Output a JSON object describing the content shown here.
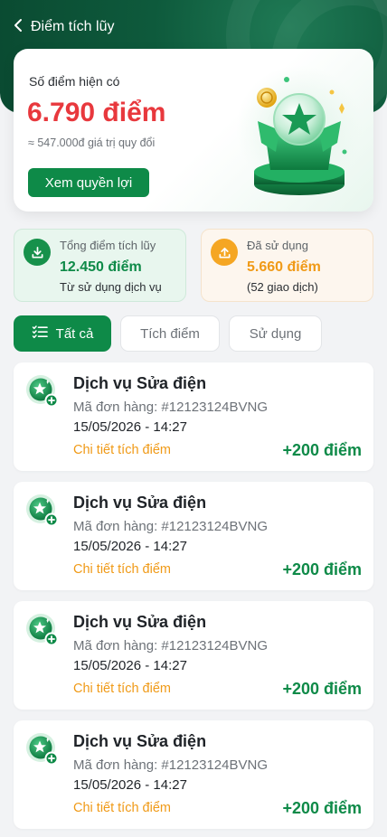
{
  "header": {
    "title": "Điểm tích lũy",
    "back_icon": "chevron-left-icon"
  },
  "points_card": {
    "label": "Số điểm hiện có",
    "value": "6.790 điểm",
    "equivalent": "≈ 547.000đ giá trị quy đổi",
    "button_label": "Xem quyền lợi",
    "illustration": "gift-box-star-illustration"
  },
  "stats": {
    "earned": {
      "icon": "download-icon",
      "label": "Tổng điểm tích lũy",
      "value": "12.450 điểm",
      "sub": "Từ sử dụng dịch vụ"
    },
    "used": {
      "icon": "upload-icon",
      "label": "Đã sử dụng",
      "value": "5.660 điểm",
      "sub": "(52 giao dịch)"
    }
  },
  "tabs": [
    {
      "label": "Tất cả",
      "icon": "list-icon",
      "active": true
    },
    {
      "label": "Tích điểm",
      "active": false
    },
    {
      "label": "Sử dụng",
      "active": false
    }
  ],
  "transactions": [
    {
      "title": "Dịch vụ Sửa điện",
      "order": "Mã đơn hàng: #12123124BVNG",
      "date": "15/05/2026 - 14:27",
      "link": "Chi tiết tích điểm",
      "points": "+200 điểm"
    },
    {
      "title": "Dịch vụ Sửa điện",
      "order": "Mã đơn hàng: #12123124BVNG",
      "date": "15/05/2026 - 14:27",
      "link": "Chi tiết tích điểm",
      "points": "+200 điểm"
    },
    {
      "title": "Dịch vụ Sửa điện",
      "order": "Mã đơn hàng: #12123124BVNG",
      "date": "15/05/2026 - 14:27",
      "link": "Chi tiết tích điểm",
      "points": "+200 điểm"
    },
    {
      "title": "Dịch vụ Sửa điện",
      "order": "Mã đơn hàng: #12123124BVNG",
      "date": "15/05/2026 - 14:27",
      "link": "Chi tiết tích điểm",
      "points": "+200 điểm"
    }
  ],
  "colors": {
    "brand_green": "#0e8a48",
    "header_dark": "#0a4a31",
    "accent_red": "#e8383d",
    "accent_orange": "#f09a17"
  }
}
